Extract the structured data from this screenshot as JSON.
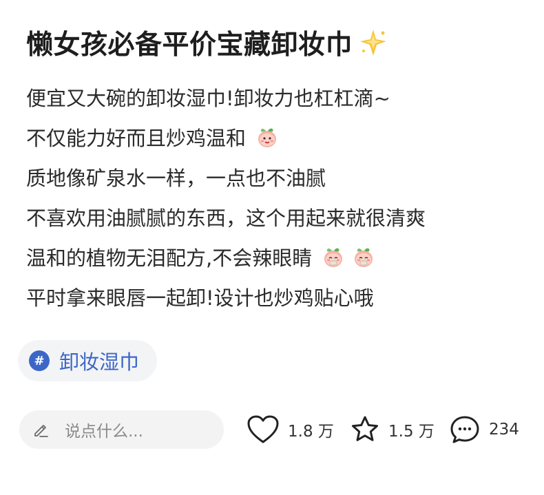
{
  "post": {
    "title": "懒女孩必备平价宝藏卸妆巾",
    "title_icon": "sparkle-star-icon",
    "lines": [
      "便宜又大碗的卸妆湿巾!卸妆力也杠杠滴~",
      "不仅能力好而且炒鸡温和",
      "质地像矿泉水一样，一点也不油腻",
      "不喜欢用油腻腻的东西，这个用起来就很清爽",
      "温和的植物无泪配方,不会辣眼睛",
      "平时拿来眼唇一起卸!设计也炒鸡贴心哦"
    ],
    "line_emojis": {
      "line_2": [
        "peach-cheers-emoji"
      ],
      "line_5": [
        "peach-blush-emoji",
        "peach-blush-emoji"
      ]
    }
  },
  "tag": {
    "symbol": "#",
    "label": "卸妆湿巾",
    "color": "#3c66c8"
  },
  "bottom_bar": {
    "comment_placeholder": "说点什么...",
    "likes": "1.8 万",
    "favorites": "1.5 万",
    "comments": "234"
  }
}
